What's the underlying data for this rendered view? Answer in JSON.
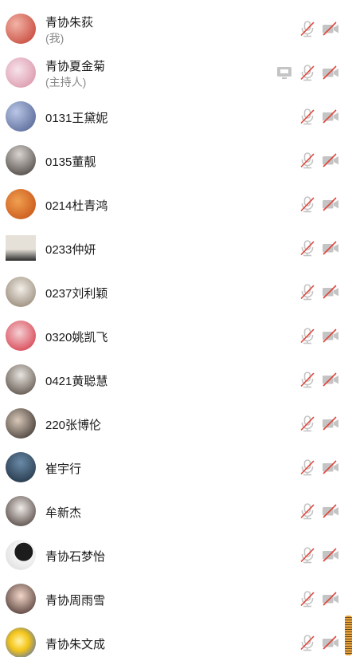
{
  "participants": [
    {
      "name": "青协朱荻",
      "role": "(我)",
      "avatar_colors": [
        "#f2b3a6",
        "#c0392b"
      ],
      "avatar_icon": "avatar-photo-icon"
    },
    {
      "name": "青协夏金菊",
      "role": "(主持人)",
      "avatar_colors": [
        "#f7e3ea",
        "#d68aa0"
      ],
      "avatar_icon": "avatar-photo-icon",
      "sharing": true
    },
    {
      "name": "0131王黛妮",
      "role": "",
      "avatar_colors": [
        "#b9c6e6",
        "#4a5b8c"
      ],
      "avatar_icon": "avatar-photo-icon"
    },
    {
      "name": "0135董靓",
      "role": "",
      "avatar_colors": [
        "#d9d4cf",
        "#3a3430"
      ],
      "avatar_icon": "avatar-photo-icon"
    },
    {
      "name": "0214杜青鸿",
      "role": "",
      "avatar_colors": [
        "#f0a050",
        "#c24a10"
      ],
      "avatar_icon": "avatar-photo-icon"
    },
    {
      "name": "0233仲妍",
      "role": "",
      "avatar_colors": [
        "#e6e1d8",
        "#2b2b2b"
      ],
      "avatar_icon": "avatar-photo-icon"
    },
    {
      "name": "0237刘利颖",
      "role": "",
      "avatar_colors": [
        "#f3efe8",
        "#8a7a68"
      ],
      "avatar_icon": "avatar-photo-icon"
    },
    {
      "name": "0320姚凯飞",
      "role": "",
      "avatar_colors": [
        "#f5d0d4",
        "#d12a3a"
      ],
      "avatar_icon": "avatar-photo-icon"
    },
    {
      "name": "0421黄聪慧",
      "role": "",
      "avatar_colors": [
        "#e8e4df",
        "#4a4036"
      ],
      "avatar_icon": "avatar-photo-icon"
    },
    {
      "name": "220张博伦",
      "role": "",
      "avatar_colors": [
        "#d8c8b8",
        "#2a2420"
      ],
      "avatar_icon": "avatar-photo-icon"
    },
    {
      "name": "崔宇行",
      "role": "",
      "avatar_colors": [
        "#6a8aa8",
        "#1a2a3a"
      ],
      "avatar_icon": "avatar-photo-icon"
    },
    {
      "name": "牟新杰",
      "role": "",
      "avatar_colors": [
        "#f0ece8",
        "#3a2c28"
      ],
      "avatar_icon": "avatar-photo-icon"
    },
    {
      "name": "青协石梦怡",
      "role": "",
      "avatar_colors": [
        "#f4f4f4",
        "#1c1c1c"
      ],
      "avatar_icon": "avatar-photo-icon"
    },
    {
      "name": "青协周雨雪",
      "role": "",
      "avatar_colors": [
        "#f3d6c8",
        "#3a2622"
      ],
      "avatar_icon": "avatar-photo-icon"
    },
    {
      "name": "青协朱文成",
      "role": "",
      "avatar_colors": [
        "#fff3a8",
        "#2a5bd7"
      ],
      "avatar_icon": "avatar-photo-icon"
    }
  ],
  "icons": {
    "mic": "mic-muted-icon",
    "camera": "camera-off-icon",
    "share": "screen-share-icon"
  },
  "colors": {
    "muted_red": "#e0453a",
    "icon_gray": "#c4c4c4",
    "name_text": "#1a1a1a",
    "role_text": "#888888"
  }
}
